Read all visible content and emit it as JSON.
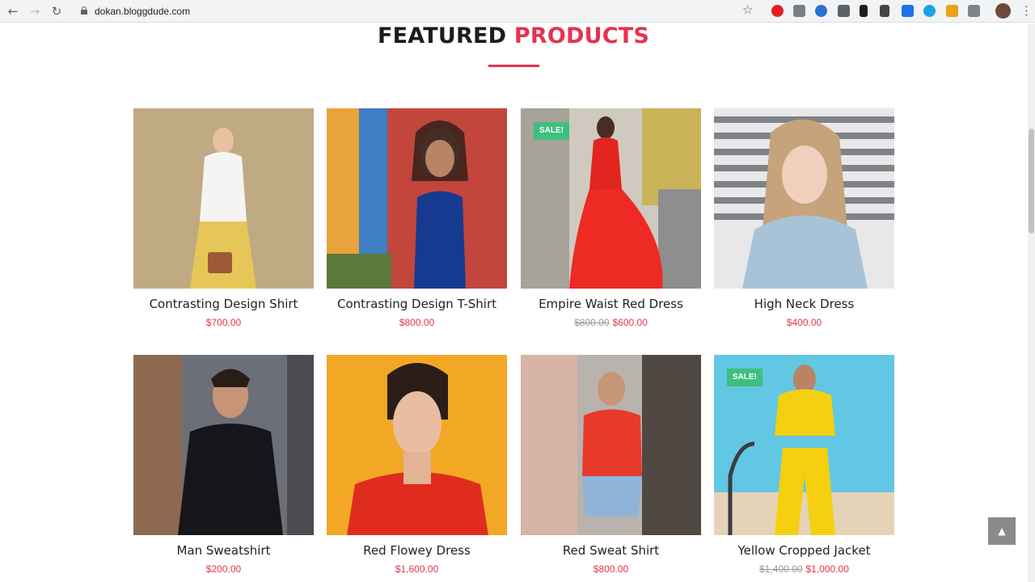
{
  "browser": {
    "url": "dokan.bloggdude.com",
    "back_icon": "arrow-left-icon",
    "forward_icon": "arrow-right-icon",
    "reload_icon": "reload-icon",
    "star_icon": "star-icon",
    "menu_icon": "vertical-dots-icon"
  },
  "section": {
    "title_dark": "FEATURED",
    "title_accent": "PRODUCTS",
    "accent_color": "#e5334f"
  },
  "products": [
    {
      "name": "Contrasting Design Shirt",
      "price": "$700.00",
      "old_price": "",
      "sale": "",
      "bg": "#c8b490"
    },
    {
      "name": "Contrasting Design T-Shirt",
      "price": "$800.00",
      "old_price": "",
      "sale": "",
      "bg": "#c2463b"
    },
    {
      "name": "Empire Waist Red Dress",
      "price": "$600.00",
      "old_price": "$800.00",
      "sale": "SALE!",
      "bg": "#cfc9bf"
    },
    {
      "name": "High Neck Dress",
      "price": "$400.00",
      "old_price": "",
      "sale": "",
      "bg": "#b9bcc0"
    },
    {
      "name": "Man Sweatshirt",
      "price": "$200.00",
      "old_price": "",
      "sale": "",
      "bg": "#6c6f77"
    },
    {
      "name": "Red Flowey Dress",
      "price": "$1,600.00",
      "old_price": "",
      "sale": "",
      "bg": "#f2a825"
    },
    {
      "name": "Red Sweat Shirt",
      "price": "$800.00",
      "old_price": "",
      "sale": "",
      "bg": "#b9b3ad"
    },
    {
      "name": "Yellow Cropped Jacket",
      "price": "$1,000.00",
      "old_price": "$1,400.00",
      "sale": "SALE!",
      "bg": "#62c7e3"
    }
  ],
  "scroll_top_icon": "chevron-up-icon"
}
